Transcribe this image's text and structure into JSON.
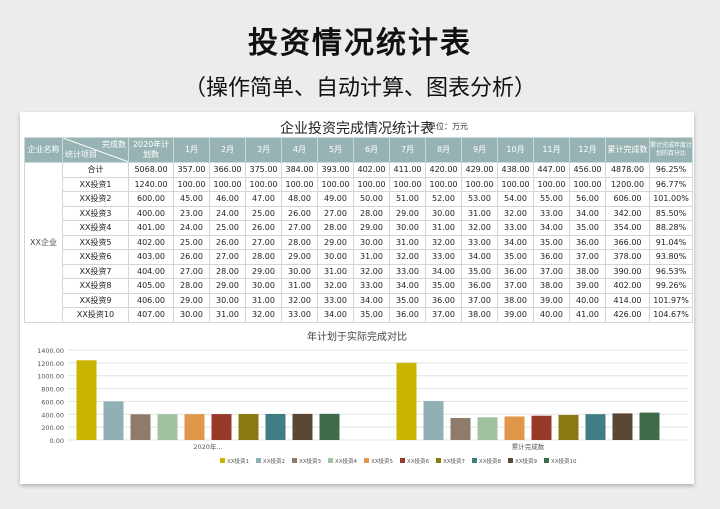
{
  "header": {
    "title": "投资情况统计表",
    "subtitle": "（操作简单、自动计算、图表分析）"
  },
  "sheet": {
    "title": "企业投资完成情况统计表",
    "unit": "单位：万元",
    "col_headers": {
      "company": "企业名称",
      "diag_top": "完成数",
      "diag_bottom": "统计项目",
      "plan": "2020年计划数",
      "months": [
        "1月",
        "2月",
        "3月",
        "4月",
        "5月",
        "6月",
        "7月",
        "8月",
        "9月",
        "10月",
        "11月",
        "12月"
      ],
      "cumulative": "累计完成数",
      "rate": "累计完成年度计划的百分比"
    },
    "company_name": "XX企业",
    "rows": [
      {
        "item": "合计",
        "plan": "5068.00",
        "months": [
          "357.00",
          "366.00",
          "375.00",
          "384.00",
          "393.00",
          "402.00",
          "411.00",
          "420.00",
          "429.00",
          "438.00",
          "447.00",
          "456.00"
        ],
        "cum": "4878.00",
        "rate": "96.25%"
      },
      {
        "item": "XX投资1",
        "plan": "1240.00",
        "months": [
          "100.00",
          "100.00",
          "100.00",
          "100.00",
          "100.00",
          "100.00",
          "100.00",
          "100.00",
          "100.00",
          "100.00",
          "100.00",
          "100.00"
        ],
        "cum": "1200.00",
        "rate": "96.77%"
      },
      {
        "item": "XX投资2",
        "plan": "600.00",
        "months": [
          "45.00",
          "46.00",
          "47.00",
          "48.00",
          "49.00",
          "50.00",
          "51.00",
          "52.00",
          "53.00",
          "54.00",
          "55.00",
          "56.00"
        ],
        "cum": "606.00",
        "rate": "101.00%"
      },
      {
        "item": "XX投资3",
        "plan": "400.00",
        "months": [
          "23.00",
          "24.00",
          "25.00",
          "26.00",
          "27.00",
          "28.00",
          "29.00",
          "30.00",
          "31.00",
          "32.00",
          "33.00",
          "34.00"
        ],
        "cum": "342.00",
        "rate": "85.50%"
      },
      {
        "item": "XX投资4",
        "plan": "401.00",
        "months": [
          "24.00",
          "25.00",
          "26.00",
          "27.00",
          "28.00",
          "29.00",
          "30.00",
          "31.00",
          "32.00",
          "33.00",
          "34.00",
          "35.00"
        ],
        "cum": "354.00",
        "rate": "88.28%"
      },
      {
        "item": "XX投资5",
        "plan": "402.00",
        "months": [
          "25.00",
          "26.00",
          "27.00",
          "28.00",
          "29.00",
          "30.00",
          "31.00",
          "32.00",
          "33.00",
          "34.00",
          "35.00",
          "36.00"
        ],
        "cum": "366.00",
        "rate": "91.04%"
      },
      {
        "item": "XX投资6",
        "plan": "403.00",
        "months": [
          "26.00",
          "27.00",
          "28.00",
          "29.00",
          "30.00",
          "31.00",
          "32.00",
          "33.00",
          "34.00",
          "35.00",
          "36.00",
          "37.00"
        ],
        "cum": "378.00",
        "rate": "93.80%"
      },
      {
        "item": "XX投资7",
        "plan": "404.00",
        "months": [
          "27.00",
          "28.00",
          "29.00",
          "30.00",
          "31.00",
          "32.00",
          "33.00",
          "34.00",
          "35.00",
          "36.00",
          "37.00",
          "38.00"
        ],
        "cum": "390.00",
        "rate": "96.53%"
      },
      {
        "item": "XX投资8",
        "plan": "405.00",
        "months": [
          "28.00",
          "29.00",
          "30.00",
          "31.00",
          "32.00",
          "33.00",
          "34.00",
          "35.00",
          "36.00",
          "37.00",
          "38.00",
          "39.00"
        ],
        "cum": "402.00",
        "rate": "99.26%"
      },
      {
        "item": "XX投资9",
        "plan": "406.00",
        "months": [
          "29.00",
          "30.00",
          "31.00",
          "32.00",
          "33.00",
          "34.00",
          "35.00",
          "36.00",
          "37.00",
          "38.00",
          "39.00",
          "40.00"
        ],
        "cum": "414.00",
        "rate": "101.97%"
      },
      {
        "item": "XX投资10",
        "plan": "407.00",
        "months": [
          "30.00",
          "31.00",
          "32.00",
          "33.00",
          "34.00",
          "35.00",
          "36.00",
          "37.00",
          "38.00",
          "39.00",
          "40.00",
          "41.00"
        ],
        "cum": "426.00",
        "rate": "104.67%"
      }
    ]
  },
  "chart_data": {
    "type": "bar",
    "title": "年计划于实际完成对比",
    "categories": [
      "2020年...",
      "累计完成数"
    ],
    "ylim": [
      0,
      1400
    ],
    "yticks": [
      "0.00",
      "200.00",
      "400.00",
      "600.00",
      "800.00",
      "1000.00",
      "1200.00",
      "1400.00"
    ],
    "grid": true,
    "legend_position": "bottom",
    "series": [
      {
        "name": "XX投资1",
        "color": "#c9b400",
        "values": [
          1240,
          1200
        ]
      },
      {
        "name": "XX投资2",
        "color": "#8fb0b5",
        "values": [
          600,
          606
        ]
      },
      {
        "name": "XX投资3",
        "color": "#8d7b6c",
        "values": [
          400,
          342
        ]
      },
      {
        "name": "XX投资4",
        "color": "#9fc2a0",
        "values": [
          401,
          354
        ]
      },
      {
        "name": "XX投资5",
        "color": "#e0964b",
        "values": [
          402,
          366
        ]
      },
      {
        "name": "XX投资6",
        "color": "#983a2a",
        "values": [
          403,
          378
        ]
      },
      {
        "name": "XX投资7",
        "color": "#8a7a12",
        "values": [
          404,
          390
        ]
      },
      {
        "name": "XX投资8",
        "color": "#3f7e83",
        "values": [
          405,
          402
        ]
      },
      {
        "name": "XX投资9",
        "color": "#5a4736",
        "values": [
          406,
          414
        ]
      },
      {
        "name": "XX投资10",
        "color": "#3e6b48",
        "values": [
          407,
          426
        ]
      }
    ]
  }
}
